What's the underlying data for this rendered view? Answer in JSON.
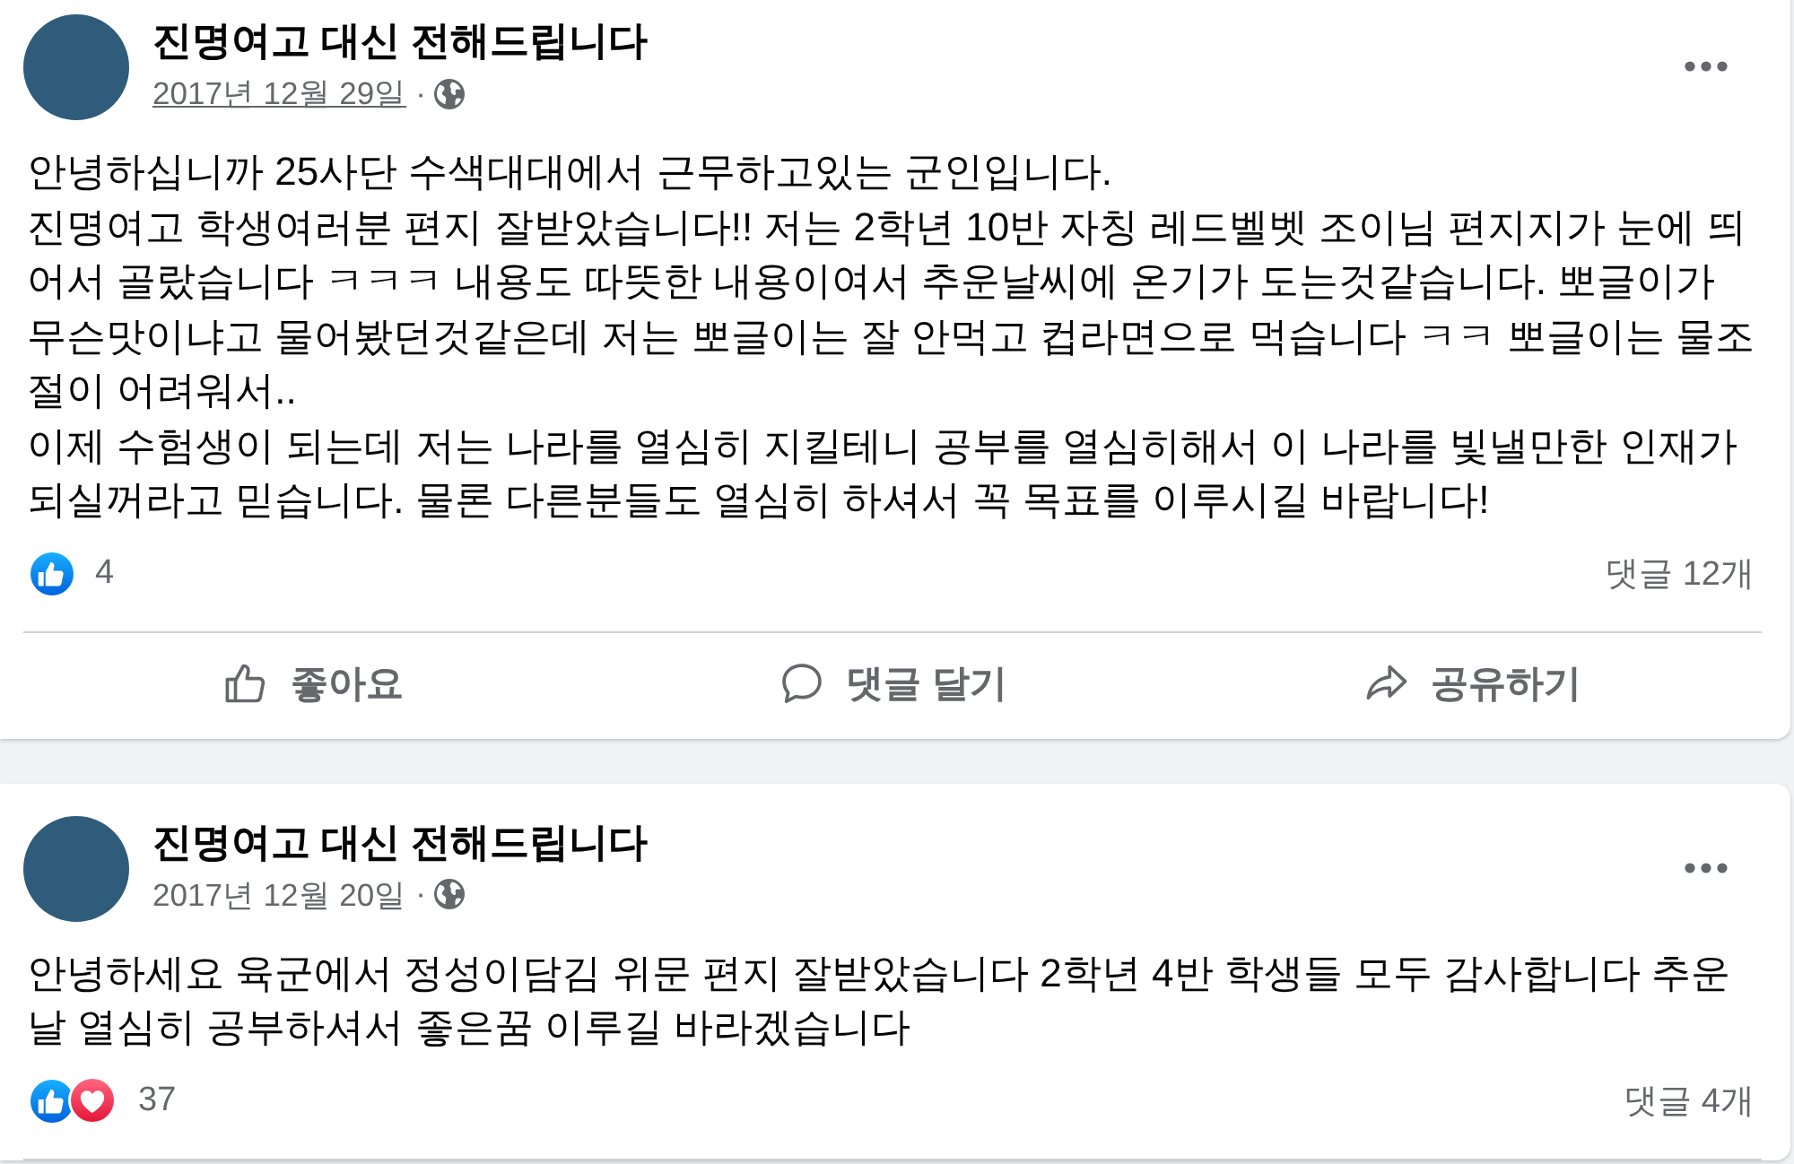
{
  "posts": [
    {
      "page_name": "진명여고 대신 전해드립니다",
      "date": "2017년 12월 29일",
      "date_hovered": true,
      "date_separator": "·",
      "text": "안녕하십니까 25사단 수색대대에서 근무하고있는 군인입니다.\n진명여고 학생여러분 편지 잘받았습니다!! 저는 2학년 10반 자칭 레드벨벳 조이님 편지지가 눈에 띄어서 골랐습니다 ㅋㅋㅋ 내용도 따뜻한 내용이여서 추운날씨에 온기가 도는것같습니다. 뽀글이가 무슨맛이냐고 물어봤던것같은데 저는 뽀글이는 잘 안먹고 컵라면으로 먹습니다 ㅋㅋ 뽀글이는 물조절이 어려워서..\n이제 수험생이 되는데 저는 나라를 열심히 지킬테니 공부를 열심히해서 이 나라를 빛낼만한 인재가 되실꺼라고 믿습니다. 물론 다른분들도 열심히 하셔서 꼭 목표를 이루시길 바랍니다!",
      "reactions": [
        {
          "kind": "like"
        }
      ],
      "reaction_count": "4",
      "comment_count": "댓글 12개",
      "actions": [
        {
          "kind": "like",
          "label": "좋아요"
        },
        {
          "kind": "comment",
          "label": "댓글 달기"
        },
        {
          "kind": "share",
          "label": "공유하기"
        }
      ]
    },
    {
      "page_name": "진명여고 대신 전해드립니다",
      "date": "2017년 12월 20일",
      "date_hovered": false,
      "date_separator": "·",
      "text": "안녕하세요 육군에서 정성이담김 위문 편지 잘받았습니다 2학년 4반 학생들 모두 감사합니다 추운날 열심히 공부하셔서 좋은꿈 이루길 바라겠습니다",
      "reactions": [
        {
          "kind": "like"
        },
        {
          "kind": "love"
        }
      ],
      "reaction_count": "37",
      "comment_count": "댓글 4개"
    }
  ]
}
